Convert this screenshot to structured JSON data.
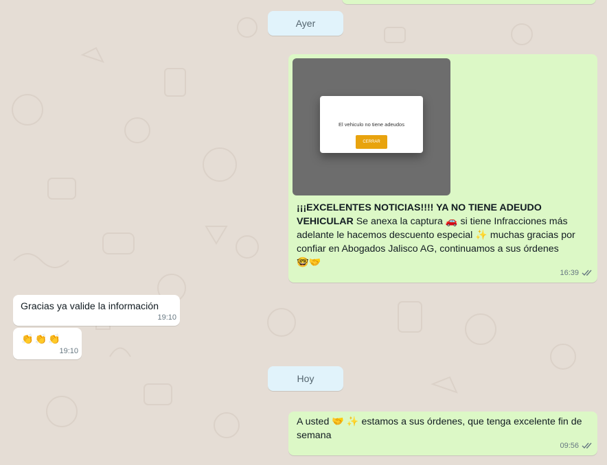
{
  "chat": {
    "date_separators": {
      "yesterday": "Ayer",
      "today": "Hoy"
    },
    "messages": [
      {
        "direction": "outgoing",
        "attachment": {
          "type": "image",
          "modal_text": "El vehiculo no tiene adeudos",
          "modal_button": "CERRAR"
        },
        "text_bold": "¡¡¡EXCELENTES NOTICIAS!!!! YA NO TIENE ADEUDO VEHICULAR",
        "text_part1": " Se anexa la captura ",
        "emoji_car": "🚗",
        "text_part2": " si tiene Infracciones más adelante le hacemos descuento especial ",
        "emoji_sparkles": "✨",
        "text_part3": " muchas gracias por confiar en Abogados Jalisco AG, continuamos a sus órdenes",
        "emoji_line": "🤓🤝",
        "time": "16:39",
        "status": "read"
      },
      {
        "direction": "incoming",
        "text": "Gracias ya valide la información",
        "time": "19:10"
      },
      {
        "direction": "incoming",
        "text": "👏👏👏",
        "time": "19:10"
      },
      {
        "direction": "outgoing",
        "text_part1": "A usted ",
        "emoji_handshake": "🤝",
        "emoji_sparkles": "✨",
        "text_part2": " estamos a sus órdenes, que tenga excelente fin de semana",
        "time": "09:56",
        "status": "read"
      }
    ]
  },
  "colors": {
    "outgoing_bubble": "#dcf8c6",
    "incoming_bubble": "#ffffff",
    "date_pill": "#e1f3fb",
    "background": "#e5ddd5",
    "read_ticks": "#667781"
  }
}
